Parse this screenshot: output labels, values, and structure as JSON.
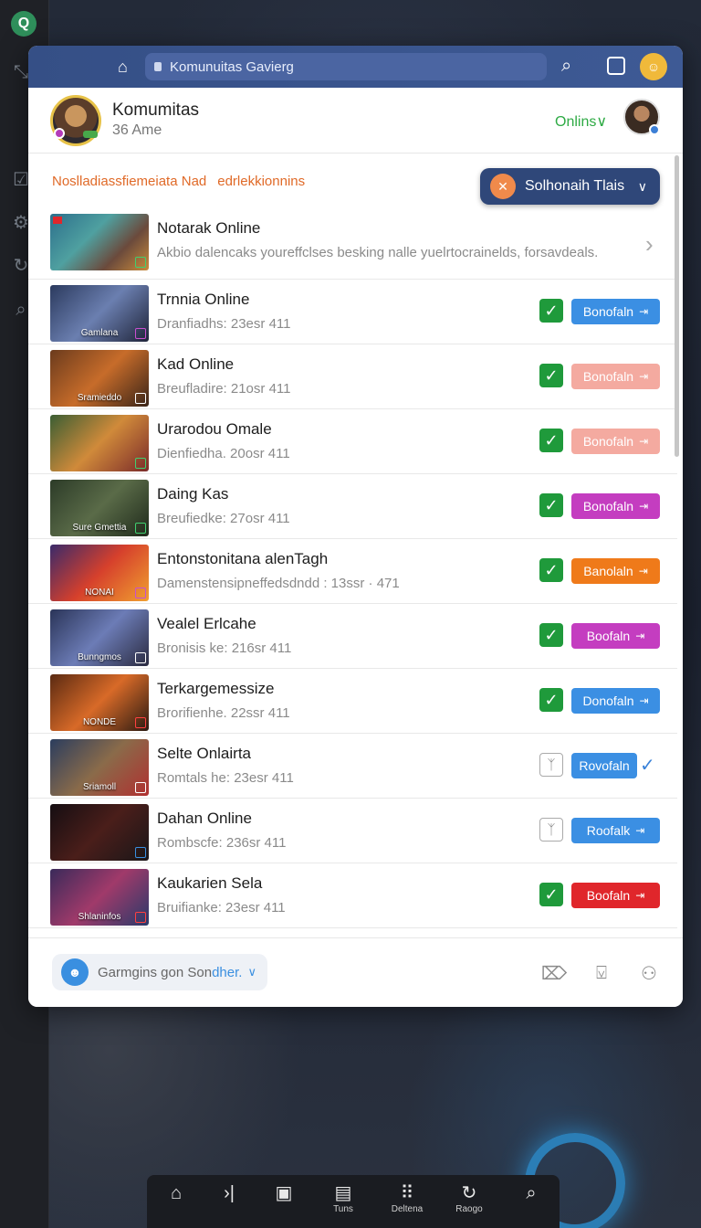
{
  "window": {
    "url_text": "Komunuitas Gavierg"
  },
  "profile": {
    "name": "Komumitas",
    "subtitle": "36 Ame",
    "status": "Onlins",
    "status_chevron": "∨"
  },
  "list_header": {
    "left": "Noslladiassfiemeiata Nad",
    "right": "edrlekkionnins"
  },
  "filter": {
    "label": "Solhonaih Tlais"
  },
  "first_item": {
    "title": "Notarak Online",
    "description": "Akbio dalencaks youreffclses besking nalle yuelrtocrainelds, forsavdeals."
  },
  "rows": [
    {
      "title": "Trnnia Online",
      "meta": "Dranfiadhs: 23esr 411",
      "thumb_caption": "Gamlana",
      "button": "Bonofaln",
      "button_color": "#3b8fe3",
      "checked": true
    },
    {
      "title": "Kad Online",
      "meta": "Breufladire: 21osr 411",
      "thumb_caption": "Sramieddo",
      "button": "Bonofaln",
      "button_color": "#f4aaa0",
      "checked": true
    },
    {
      "title": "Urarodou Omale",
      "meta": "Dienfiedha. 20osr 411",
      "thumb_caption": "",
      "button": "Bonofaln",
      "button_color": "#f4aaa0",
      "checked": true
    },
    {
      "title": "Daing Kas",
      "meta": "Breufiedke: 27osr 411",
      "thumb_caption": "Sure Gmettia",
      "button": "Bonofaln",
      "button_color": "#c43dc0",
      "checked": true
    },
    {
      "title": "Entonstonitana alenTagh",
      "meta": "Damenstensipneffedsdndd : 13ssr · 471",
      "thumb_caption": "NONAI",
      "button": "Banolaln",
      "button_color": "#ef7a1a",
      "checked": true
    },
    {
      "title": "Vealel Erlcahe",
      "meta": "Bronisis ke: 216sr 411",
      "thumb_caption": "Bunngmos",
      "button": "Boofaln",
      "button_color": "#c43dc0",
      "checked": true
    },
    {
      "title": "Terkargemessize",
      "meta": "Brorifienhe. 22ssr 411",
      "thumb_caption": "NONDE",
      "button": "Donofaln",
      "button_color": "#3b8fe3",
      "checked": true
    },
    {
      "title": "Selte Onlairta",
      "meta": "Romtals he: 23esr 411",
      "thumb_caption": "Sriamoll",
      "button": "Rovofaln",
      "button_color": "#3b8fe3",
      "checked": false
    },
    {
      "title": "Dahan Online",
      "meta": "Rombscfe: 236sr 411",
      "thumb_caption": "",
      "button": "Roofalk",
      "button_color": "#3b8fe3",
      "checked": false
    },
    {
      "title": "Kaukarien Sela",
      "meta": "Bruifianke: 23esr 411",
      "thumb_caption": "Shlaninfos",
      "button": "Boofaln",
      "button_color": "#e0262b",
      "checked": true
    }
  ],
  "footer": {
    "composer_text": "Garmgins gon Son",
    "composer_link": "dher.",
    "composer_chevron": "∨"
  },
  "dock": {
    "items": [
      {
        "label": ""
      },
      {
        "label": ""
      },
      {
        "label": ""
      },
      {
        "label": "Tuns"
      },
      {
        "label": "Deltena"
      },
      {
        "label": "Raogo"
      },
      {
        "label": ""
      }
    ]
  }
}
